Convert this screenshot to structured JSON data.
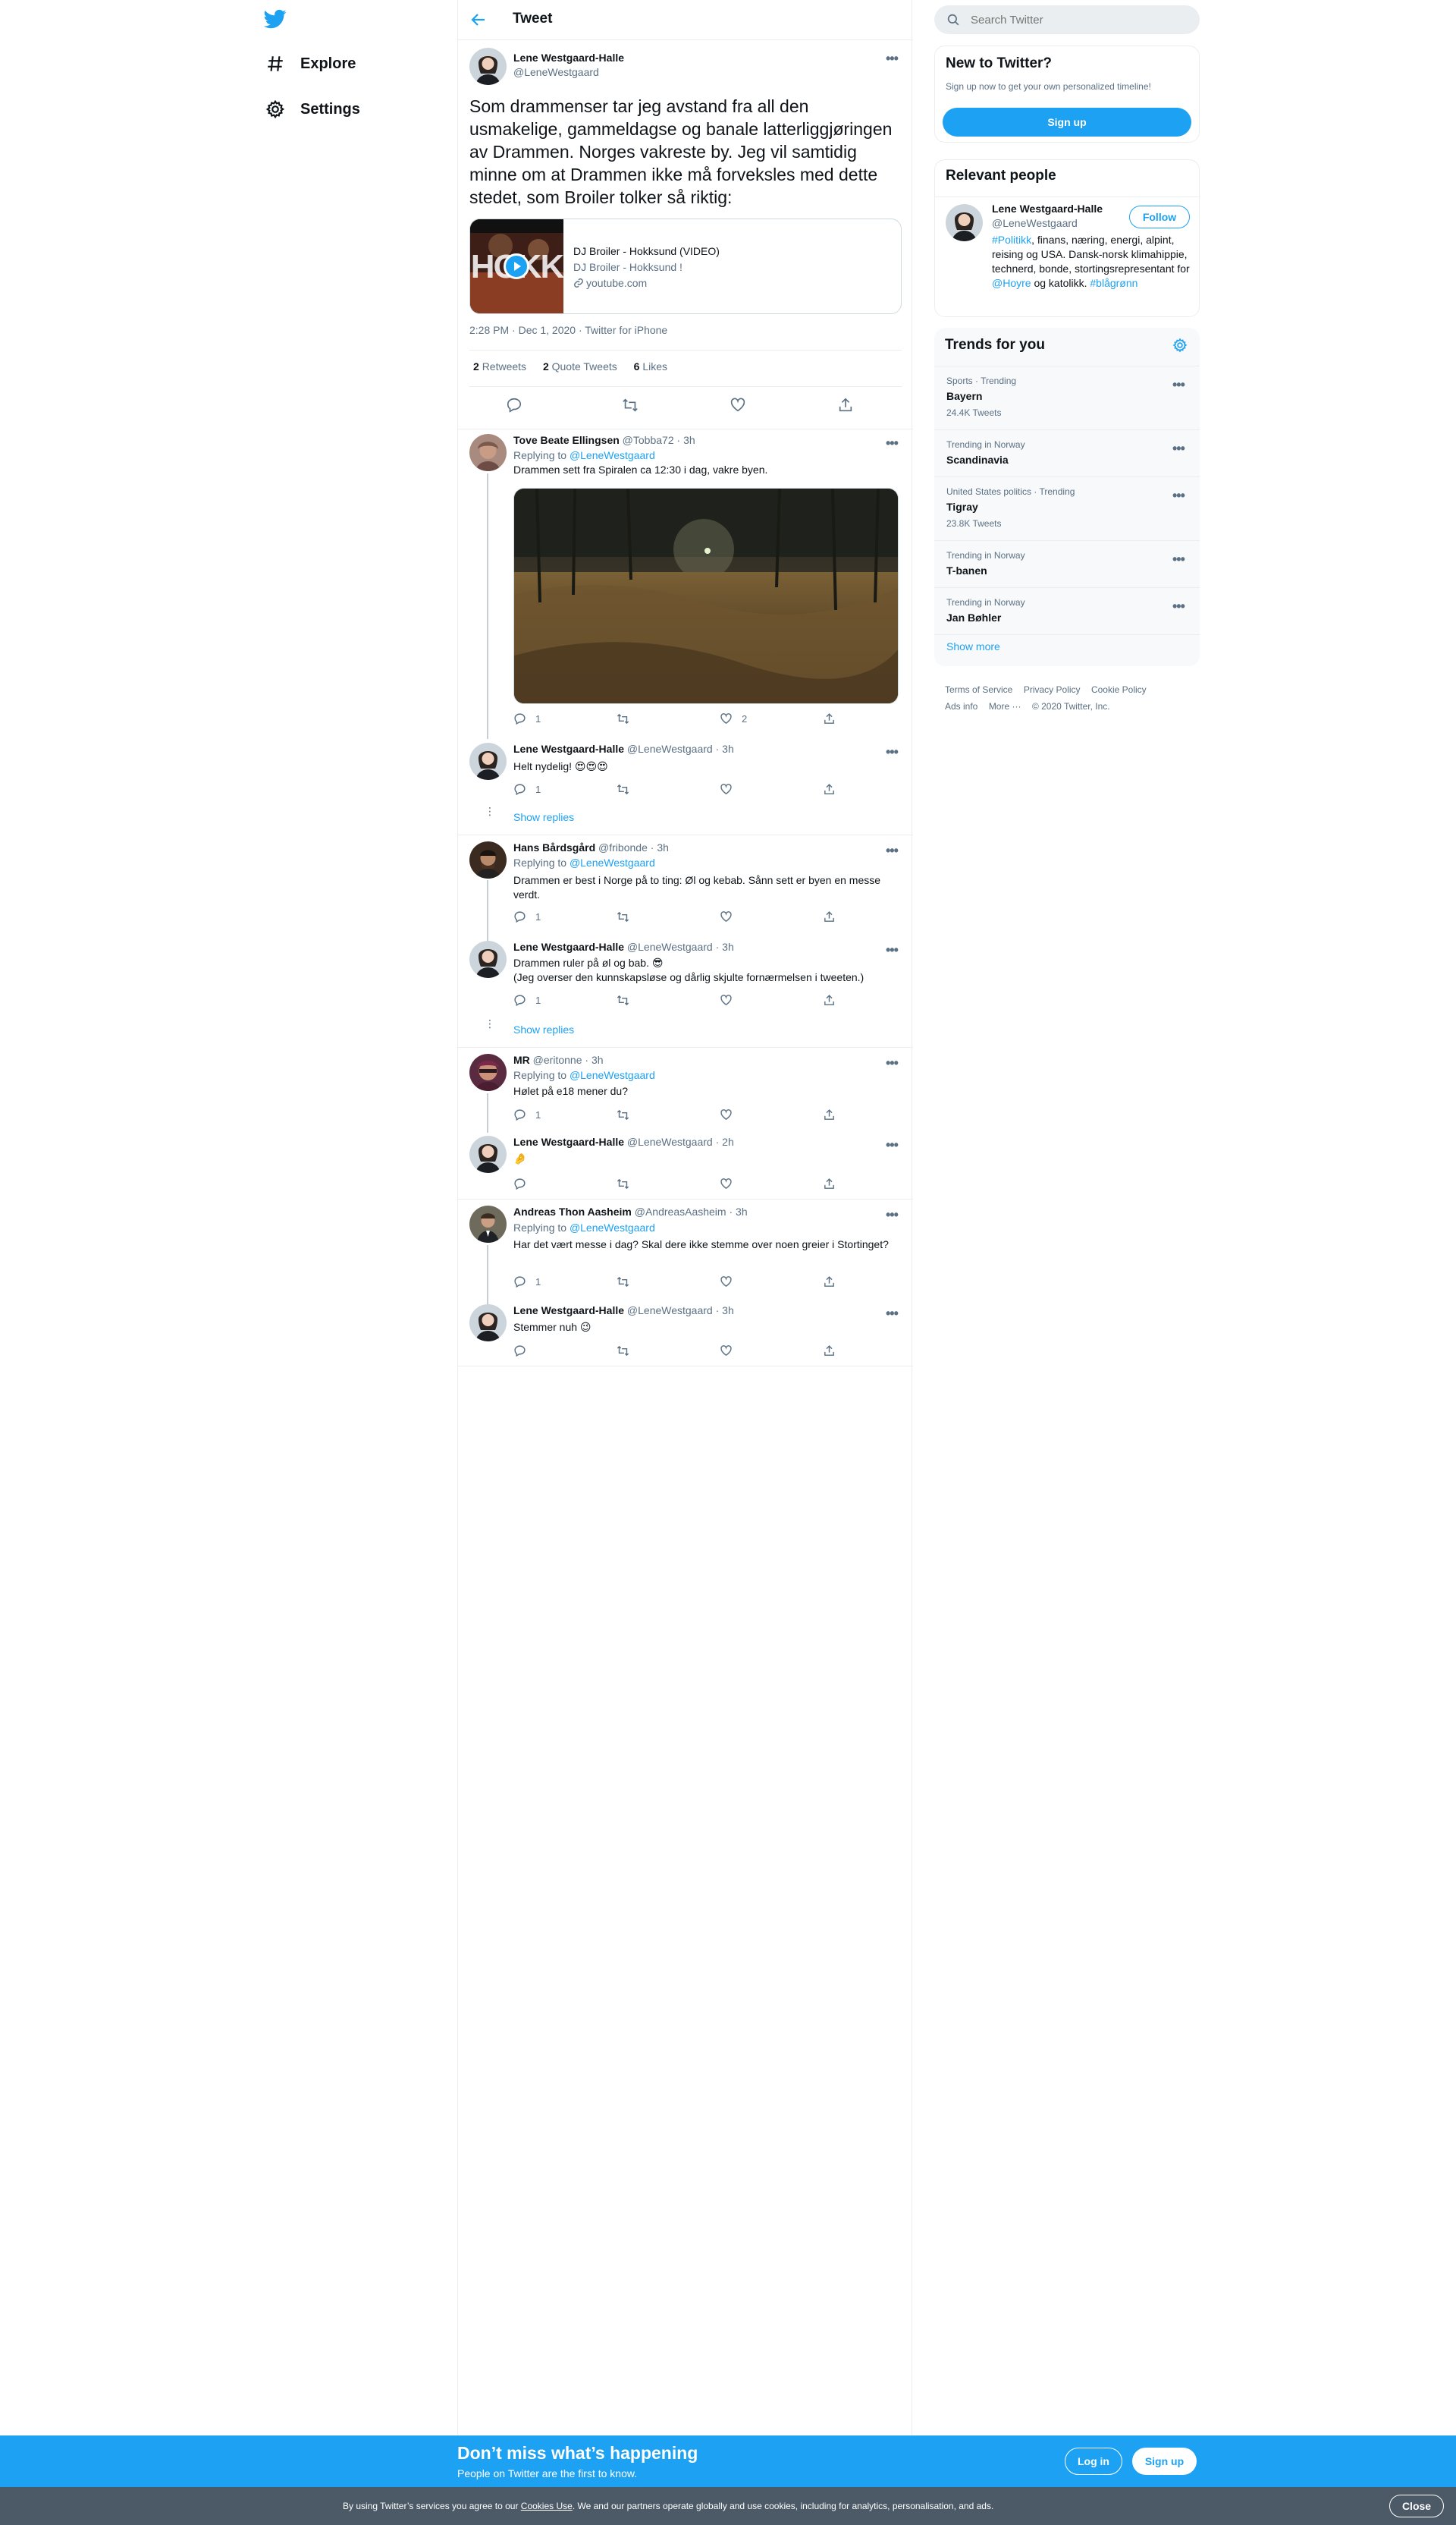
{
  "colors": {
    "accent": "#1da1f2",
    "muted": "#5b7083",
    "border": "#ebeef0",
    "cookie_bg": "#4b5a66"
  },
  "nav": {
    "logo": "twitter-bird-icon",
    "items": [
      {
        "label": "Explore",
        "icon": "hashtag-icon"
      },
      {
        "label": "Settings",
        "icon": "gear-icon"
      }
    ]
  },
  "header": {
    "title": "Tweet",
    "back_icon": "arrow-left-icon"
  },
  "main_tweet": {
    "name": "Lene Westgaard-Halle",
    "handle": "@LeneWestgaard",
    "text": "Som drammenser tar jeg avstand fra all den usmakelige, gammeldagse og banale latterliggjøringen av Drammen. Norges vakreste by. Jeg vil samtidig minne om at Drammen ikke må forveksles med dette stedet, som Broiler tolker så riktig:",
    "card": {
      "title": "DJ Broiler - Hokksund (VIDEO)",
      "description": "DJ Broiler - Hokksund !",
      "domain": "youtube.com",
      "thumb_text": "HOKK"
    },
    "time": "2:28 PM · Dec 1, 2020",
    "source": "Twitter for iPhone",
    "stats": [
      {
        "count": "2",
        "label": "Retweets"
      },
      {
        "count": "2",
        "label": "Quote Tweets"
      },
      {
        "count": "6",
        "label": "Likes"
      }
    ]
  },
  "replies": [
    {
      "name": "Tove Beate Ellingsen",
      "handle": "@Tobba72",
      "time": "3h",
      "replying_label": "Replying to",
      "replying_to": "@LeneWestgaard",
      "text": "Drammen sett fra Spiralen ca 12:30 i dag, vakre byen.",
      "replies": "1",
      "retweets": "",
      "likes": "2"
    },
    {
      "name": "Lene Westgaard-Halle",
      "handle": "@LeneWestgaard",
      "time": "3h",
      "text": "Helt nydelig! 😍😍😍",
      "replies": "1",
      "retweets": "",
      "likes": ""
    },
    {
      "name": "Hans Bårdsgård",
      "handle": "@fribonde",
      "time": "3h",
      "replying_label": "Replying to",
      "replying_to": "@LeneWestgaard",
      "text": "Drammen er best i Norge på to ting: Øl og kebab. Sånn sett er byen en messe verdt.",
      "replies": "1",
      "retweets": "",
      "likes": ""
    },
    {
      "name": "Lene Westgaard-Halle",
      "handle": "@LeneWestgaard",
      "time": "3h",
      "text": "Drammen ruler på øl og bab. 😎\n(Jeg overser den kunnskapsløse og dårlig skjulte fornærmelsen i tweeten.)",
      "replies": "1",
      "retweets": "",
      "likes": ""
    },
    {
      "name": "MR",
      "handle": "@eritonne",
      "time": "3h",
      "replying_label": "Replying to",
      "replying_to": "@LeneWestgaard",
      "text": "Hølet på e18 mener du?",
      "replies": "1",
      "retweets": "",
      "likes": ""
    },
    {
      "name": "Lene Westgaard-Halle",
      "handle": "@LeneWestgaard",
      "time": "2h",
      "text": "🤌",
      "replies": "",
      "retweets": "",
      "likes": ""
    },
    {
      "name": "Andreas Thon Aasheim",
      "handle": "@AndreasAasheim",
      "time": "3h",
      "replying_label": "Replying to",
      "replying_to": "@LeneWestgaard",
      "text": "Har det vært messe i dag? Skal dere ikke stemme over noen greier i Stortinget?",
      "replies": "1",
      "retweets": "",
      "likes": ""
    },
    {
      "name": "Lene Westgaard-Halle",
      "handle": "@LeneWestgaard",
      "time": "3h",
      "text": "Stemmer nuh 😉",
      "replies": "",
      "retweets": "",
      "likes": ""
    }
  ],
  "show_replies_label": "Show replies",
  "search": {
    "placeholder": "Search Twitter"
  },
  "new_to_twitter": {
    "title": "New to Twitter?",
    "subtitle": "Sign up now to get your own personalized timeline!",
    "button": "Sign up"
  },
  "relevant_people": {
    "title": "Relevant people",
    "name": "Lene Westgaard-Halle",
    "handle": "@LeneWestgaard",
    "follow": "Follow",
    "bio_tag1": "#Politikk",
    "bio_text1": ", finans, næring, energi, alpint, reising og USA. Dansk-norsk klimahippie, technerd, bonde, stortingsrepresentant for ",
    "bio_mention": "@Hoyre",
    "bio_text2": " og katolikk. ",
    "bio_tag2": "#blågrønn"
  },
  "trends": {
    "title": "Trends for you",
    "items": [
      {
        "category": "Sports · Trending",
        "name": "Bayern",
        "count": "24.4K Tweets"
      },
      {
        "category": "Trending in Norway",
        "name": "Scandinavia",
        "count": ""
      },
      {
        "category": "United States politics · Trending",
        "name": "Tigray",
        "count": "23.8K Tweets"
      },
      {
        "category": "Trending in Norway",
        "name": "T-banen",
        "count": ""
      },
      {
        "category": "Trending in Norway",
        "name": "Jan Bøhler",
        "count": ""
      }
    ],
    "show_more": "Show more"
  },
  "footer": {
    "links": [
      "Terms of Service",
      "Privacy Policy",
      "Cookie Policy",
      "Ads info",
      "More"
    ],
    "copyright": "© 2020 Twitter, Inc."
  },
  "bottom_bar": {
    "title": "Don’t miss what’s happening",
    "subtitle": "People on Twitter are the first to know.",
    "login": "Log in",
    "signup": "Sign up"
  },
  "cookie_bar": {
    "text_before": "By using Twitter’s services you agree to our",
    "link": "Cookies Use",
    "text_after": ". We and our partners operate globally and use cookies, including for analytics, personalisation, and ads.",
    "close": "Close"
  }
}
